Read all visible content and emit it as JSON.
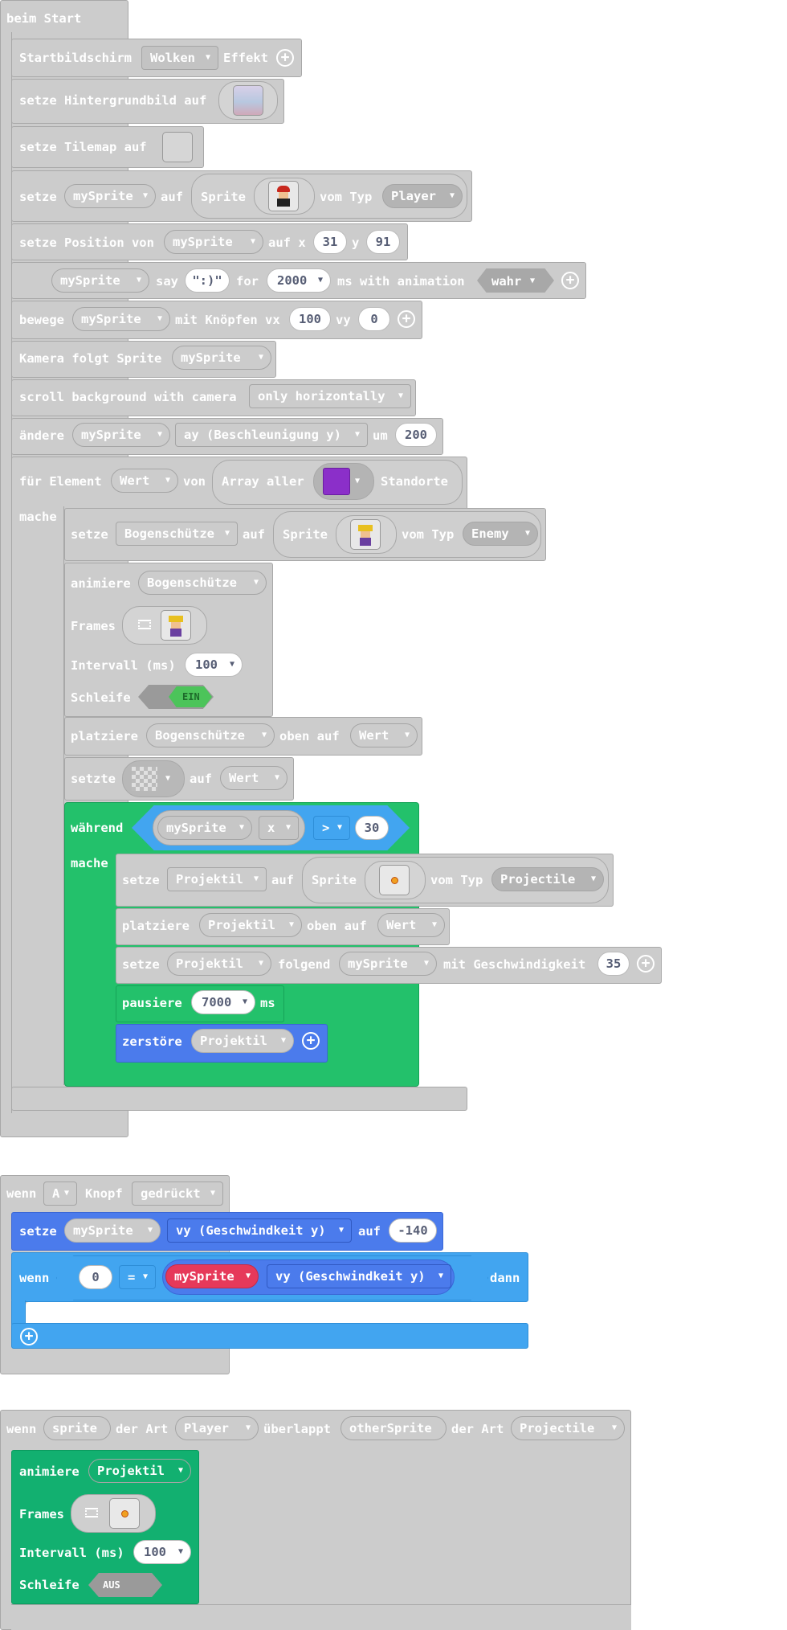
{
  "start": {
    "hat": "beim Start",
    "splash": {
      "label": "Startbildschirm",
      "effect_value": "Wolken",
      "effect_label": "Effekt"
    },
    "background": {
      "label": "setze Hintergrundbild auf"
    },
    "tilemap": {
      "label": "setze Tilemap auf"
    },
    "set_sprite": {
      "label": "setze",
      "var": "mySprite",
      "to": "auf",
      "sprite": "Sprite",
      "of_kind": "vom Typ",
      "kind": "Player"
    },
    "set_position": {
      "label": "setze Position von",
      "var": "mySprite",
      "at_x": "auf x",
      "x": "31",
      "y_label": "y",
      "y": "91"
    },
    "say": {
      "var": "mySprite",
      "say": "say",
      "text": "\":)\"",
      "for": "for",
      "ms": "2000",
      "ms_label": "ms with animation",
      "anim": "wahr"
    },
    "move": {
      "label": "bewege",
      "var": "mySprite",
      "with": "mit Knöpfen vx",
      "vx": "100",
      "vy_label": "vy",
      "vy": "0"
    },
    "camera": {
      "label": "Kamera folgt Sprite",
      "var": "mySprite"
    },
    "scroll": {
      "label": "scroll background with camera",
      "mode": "only horizontally"
    },
    "change": {
      "label": "ändere",
      "var": "mySprite",
      "prop": "ay (Beschleunigung y)",
      "by": "um",
      "value": "200"
    },
    "for_each": {
      "label": "für Element",
      "var": "Wert",
      "of": "von",
      "array": "Array aller",
      "suffix": "Standorte",
      "do": "mache"
    },
    "archer": {
      "set": "setze",
      "var": "Bogenschütze",
      "to": "auf",
      "sprite": "Sprite",
      "of_kind": "vom Typ",
      "kind": "Enemy",
      "animate": "animiere",
      "frames": "Frames",
      "interval": "Intervall (ms)",
      "interval_value": "100",
      "loop": "Schleife",
      "loop_value": "EIN",
      "place": "platziere",
      "place_on": "oben auf",
      "place_target": "Wert",
      "set_tile": "setzte",
      "set_tile_on": "auf",
      "set_tile_target": "Wert"
    },
    "while": {
      "label": "während",
      "var": "mySprite",
      "prop": "x",
      "op": ">",
      "value": "30",
      "do": "mache",
      "proj": {
        "set": "setze",
        "var": "Projektil",
        "to": "auf",
        "sprite": "Sprite",
        "of_kind": "vom Typ",
        "kind": "Projectile"
      },
      "place": {
        "label": "platziere",
        "var": "Projektil",
        "on": "oben auf",
        "target": "Wert"
      },
      "follow": {
        "label": "setze",
        "var": "Projektil",
        "follow": "folgend",
        "target": "mySprite",
        "speed_label": "mit Geschwindigkeit",
        "speed": "35"
      },
      "pause": {
        "label": "pausiere",
        "value": "7000",
        "unit": "ms"
      },
      "destroy": {
        "label": "zerstöre",
        "var": "Projektil"
      }
    }
  },
  "button": {
    "when": "wenn",
    "key": "A",
    "key_label": "Knopf",
    "event": "gedrückt",
    "set": {
      "label": "setze",
      "var": "mySprite",
      "prop": "vy (Geschwindkeit y)",
      "to": "auf",
      "value": "-140"
    },
    "if": {
      "label": "wenn",
      "left": "0",
      "op": "=",
      "var": "mySprite",
      "prop": "vy (Geschwindkeit y)",
      "then": "dann"
    }
  },
  "overlap": {
    "when": "wenn",
    "sprite": "sprite",
    "of_kind": "der Art",
    "kind": "Player",
    "overlaps": "überlappt",
    "other": "otherSprite",
    "of_kind2": "der Art",
    "kind2": "Projectile",
    "animate": "animiere",
    "var": "Projektil",
    "frames": "Frames",
    "interval": "Intervall (ms)",
    "interval_value": "100",
    "loop": "Schleife",
    "loop_value": "AUS"
  }
}
